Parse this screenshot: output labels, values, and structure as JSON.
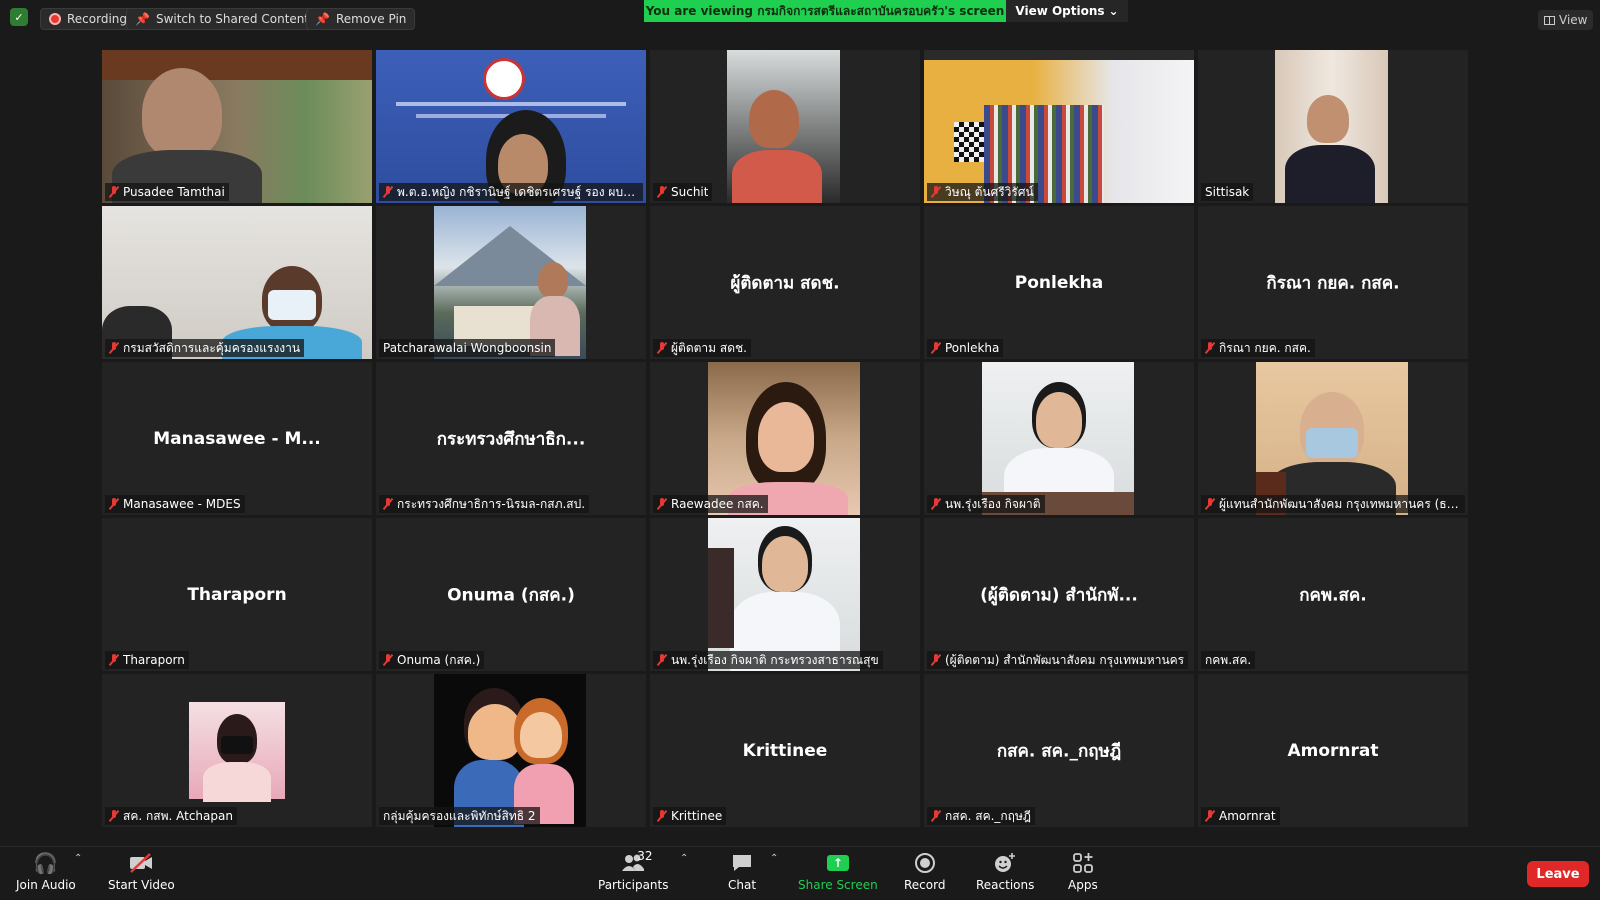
{
  "top_bar": {
    "recording_label": "Recording",
    "switch_label": "Switch to Shared Content",
    "remove_pin_label": "Remove Pin",
    "viewing_banner": "You are viewing กรมกิจการสตรีและสถาบันครอบครัว's screen",
    "view_options_label": "View Options",
    "view_label": "View"
  },
  "tiles": [
    {
      "name": "Pusadee Tamthai",
      "center": "",
      "muted": true
    },
    {
      "name": "พ.ต.อ.หญิง กชิรานิษฐ์ เดชิตรเศรษฐ์ รอง ผบก. ...",
      "center": "",
      "muted": true
    },
    {
      "name": "Suchit",
      "center": "",
      "muted": true
    },
    {
      "name": "วิษณุ ต้นศรีวิรัศน์",
      "center": "",
      "muted": true
    },
    {
      "name": "Sittisak",
      "center": "",
      "muted": false
    },
    {
      "name": "กรมสวัสดิการและคุ้มครองแรงงาน",
      "center": "",
      "muted": true
    },
    {
      "name": "Patcharawalai Wongboonsin",
      "center": "",
      "muted": false
    },
    {
      "name": "ผู้ติดตาม สดช.",
      "center": "ผู้ติดตาม สดช.",
      "muted": true
    },
    {
      "name": "Ponlekha",
      "center": "Ponlekha",
      "muted": true
    },
    {
      "name": "กิรณา กยค. กสค.",
      "center": "กิรณา กยค. กสค.",
      "muted": true
    },
    {
      "name": "Manasawee - MDES",
      "center": "Manasawee - M...",
      "muted": true
    },
    {
      "name": "กระทรวงศึกษาธิการ-นิรมล-กสภ.สป.",
      "center": "กระทรวงศึกษาธิก...",
      "muted": true
    },
    {
      "name": "Raewadee กสค.",
      "center": "",
      "muted": true
    },
    {
      "name": "นพ.รุ่งเรือง กิจผาติ",
      "center": "",
      "muted": true
    },
    {
      "name": "ผู้แทนสำนักพัฒนาสังคม กรุงเทพมหานคร (ธนิต ...",
      "center": "",
      "muted": true
    },
    {
      "name": "Tharaporn",
      "center": "Tharaporn",
      "muted": true
    },
    {
      "name": "Onuma (กสค.)",
      "center": "Onuma (กสค.)",
      "muted": true
    },
    {
      "name": "นพ.รุ่งเรือง กิจผาติ กระทรวงสาธารณสุข",
      "center": "",
      "muted": true
    },
    {
      "name": "(ผู้ติดตาม) สำนักพัฒนาสังคม กรุงเทพมหานคร",
      "center": "(ผู้ติดตาม) สำนักพั...",
      "muted": true
    },
    {
      "name": "กคพ.สค.",
      "center": "กคพ.สค.",
      "muted": false
    },
    {
      "name": "สค. กสพ. Atchapan",
      "center": "",
      "muted": true
    },
    {
      "name": "กลุ่มคุ้มครองและพิทักษ์สิทธิ 2",
      "center": "",
      "muted": false
    },
    {
      "name": "Krittinee",
      "center": "Krittinee",
      "muted": true
    },
    {
      "name": "กสค. สค._กฤษฎี",
      "center": "กสค. สค._กฤษฎี",
      "muted": true
    },
    {
      "name": "Amornrat",
      "center": "Amornrat",
      "muted": true
    }
  ],
  "toolbar": {
    "join_audio": "Join Audio",
    "start_video": "Start Video",
    "participants": "Participants",
    "participants_count": "32",
    "chat": "Chat",
    "share_screen": "Share Screen",
    "record": "Record",
    "reactions": "Reactions",
    "apps": "Apps",
    "leave": "Leave"
  },
  "colors": {
    "accent_green": "#1fcf4f",
    "leave_red": "#e02828",
    "muted_red": "#e53935",
    "tile_bg": "#232323"
  }
}
